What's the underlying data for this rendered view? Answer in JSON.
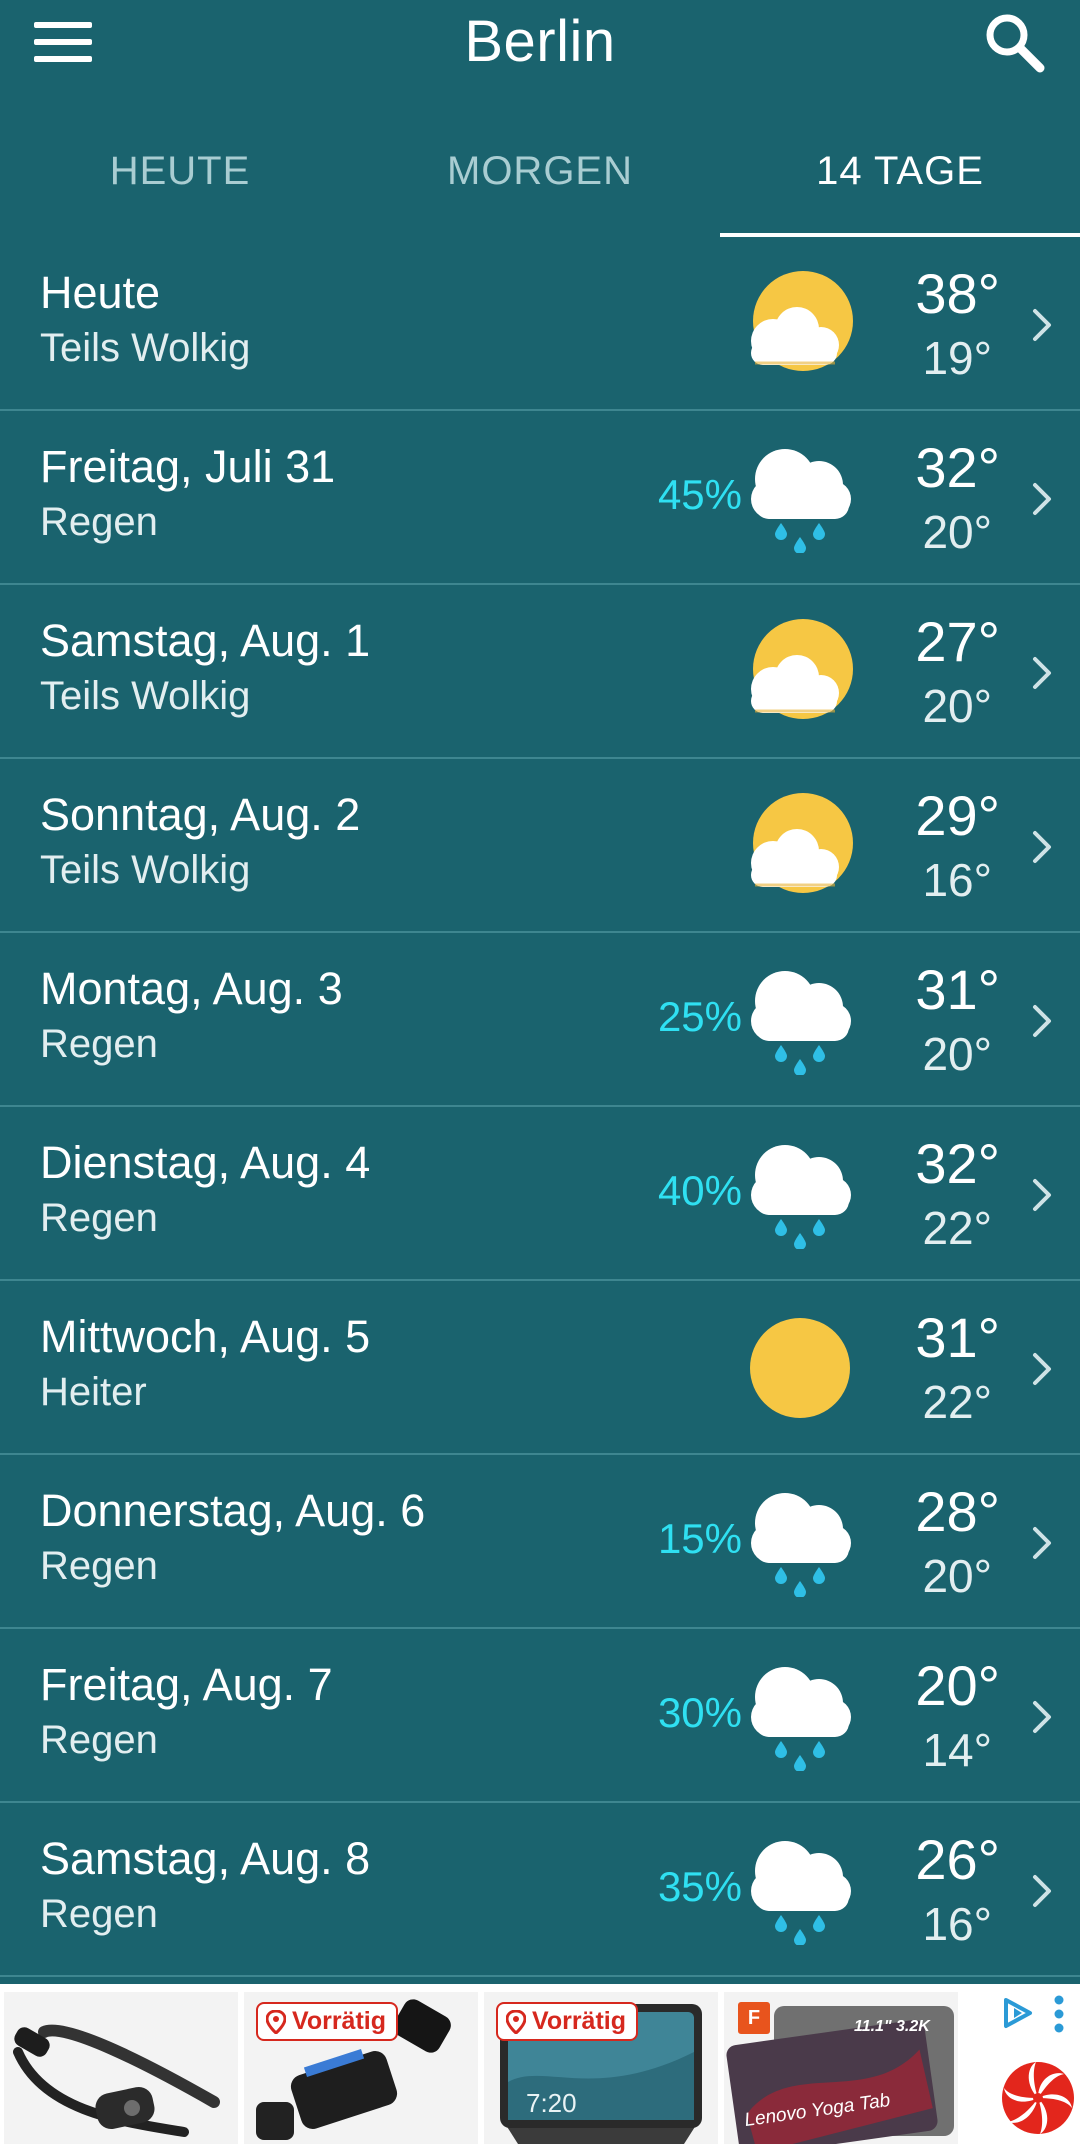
{
  "header": {
    "city": "Berlin",
    "menu_icon": "hamburger-menu-icon",
    "search_icon": "search-icon"
  },
  "tabs": [
    {
      "label": "HEUTE",
      "active": false
    },
    {
      "label": "MORGEN",
      "active": false
    },
    {
      "label": "14 TAGE",
      "active": true
    }
  ],
  "days": [
    {
      "day": "Heute",
      "condition": "Teils Wolkig",
      "precip": "",
      "icon": "partly-cloudy-icon",
      "high": "38°",
      "low": "19°"
    },
    {
      "day": "Freitag, Juli 31",
      "condition": "Regen",
      "precip": "45%",
      "icon": "rain-cloud-icon",
      "high": "32°",
      "low": "20°"
    },
    {
      "day": "Samstag, Aug. 1",
      "condition": "Teils Wolkig",
      "precip": "",
      "icon": "partly-cloudy-icon",
      "high": "27°",
      "low": "20°"
    },
    {
      "day": "Sonntag, Aug. 2",
      "condition": "Teils Wolkig",
      "precip": "",
      "icon": "partly-cloudy-icon",
      "high": "29°",
      "low": "16°"
    },
    {
      "day": "Montag, Aug. 3",
      "condition": "Regen",
      "precip": "25%",
      "icon": "rain-cloud-icon",
      "high": "31°",
      "low": "20°"
    },
    {
      "day": "Dienstag, Aug. 4",
      "condition": "Regen",
      "precip": "40%",
      "icon": "rain-cloud-icon",
      "high": "32°",
      "low": "22°"
    },
    {
      "day": "Mittwoch, Aug. 5",
      "condition": "Heiter",
      "precip": "",
      "icon": "sun-icon",
      "high": "31°",
      "low": "22°"
    },
    {
      "day": "Donnerstag, Aug. 6",
      "condition": "Regen",
      "precip": "15%",
      "icon": "rain-cloud-icon",
      "high": "28°",
      "low": "20°"
    },
    {
      "day": "Freitag, Aug. 7",
      "condition": "Regen",
      "precip": "30%",
      "icon": "rain-cloud-icon",
      "high": "20°",
      "low": "14°"
    },
    {
      "day": "Samstag, Aug. 8",
      "condition": "Regen",
      "precip": "35%",
      "icon": "rain-cloud-icon",
      "high": "26°",
      "low": "16°"
    }
  ],
  "ad": {
    "badge_label": "Vorrätig",
    "screen_time": "7:20",
    "tablet_caption": "Lenovo Yoga Tab",
    "tablet_specs": "11.1\" 3.2K",
    "energy_label": "F",
    "adchoices_icon": "adchoices-icon",
    "more_icon": "more-vert-icon"
  },
  "colors": {
    "background": "#1a636e",
    "precip": "#2fe0f2",
    "sun": "#f6c744",
    "divider": "#3e8690"
  }
}
